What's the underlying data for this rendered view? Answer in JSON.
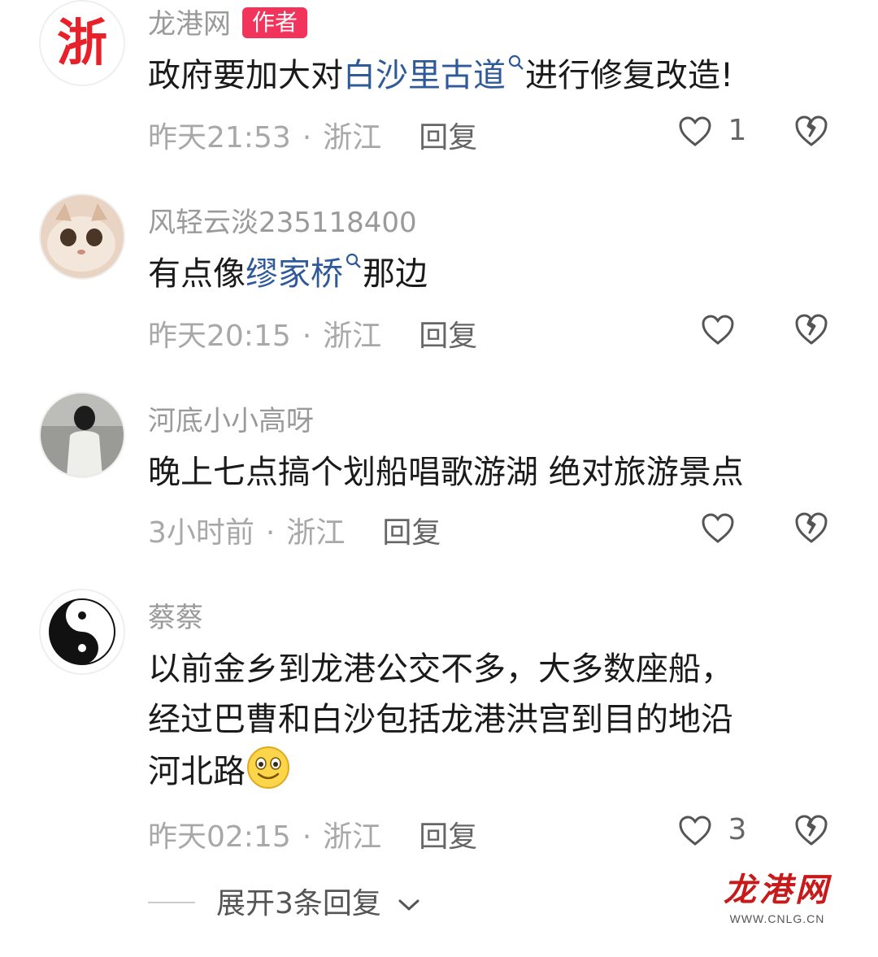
{
  "comments": [
    {
      "username": "龙港网",
      "badge": "作者",
      "content_pre": "政府要加大对",
      "content_link": "白沙里古道",
      "content_post": "进行修复改造!",
      "time": "昨天21:53",
      "location": "浙江",
      "reply": "回复",
      "likes": "1"
    },
    {
      "username": "风轻云淡235118400",
      "content_pre": "有点像",
      "content_link": "缪家桥",
      "content_post": "那边",
      "time": "昨天20:15",
      "location": "浙江",
      "reply": "回复"
    },
    {
      "username": "河底小小高呀",
      "content": "晚上七点搞个划船唱歌游湖 绝对旅游景点",
      "time": "3小时前",
      "location": "浙江",
      "reply": "回复"
    },
    {
      "username": "蔡蔡",
      "content_line1": "以前金乡到龙港公交不多，大多数座船，",
      "content_line2": "经过巴曹和白沙包括龙港洪宫到目的地沿",
      "content_line3": "河北路",
      "time": "昨天02:15",
      "location": "浙江",
      "reply": "回复",
      "likes": "3"
    }
  ],
  "expand_replies": "展开3条回复",
  "avatar_logo_text": "浙",
  "meta_separator": "·",
  "watermark": {
    "title": "龙港网",
    "url": "WWW.CNLG.CN"
  },
  "colors": {
    "link": "#2f5a99",
    "badge": "#f2335b",
    "watermark": "#c81a1a"
  }
}
